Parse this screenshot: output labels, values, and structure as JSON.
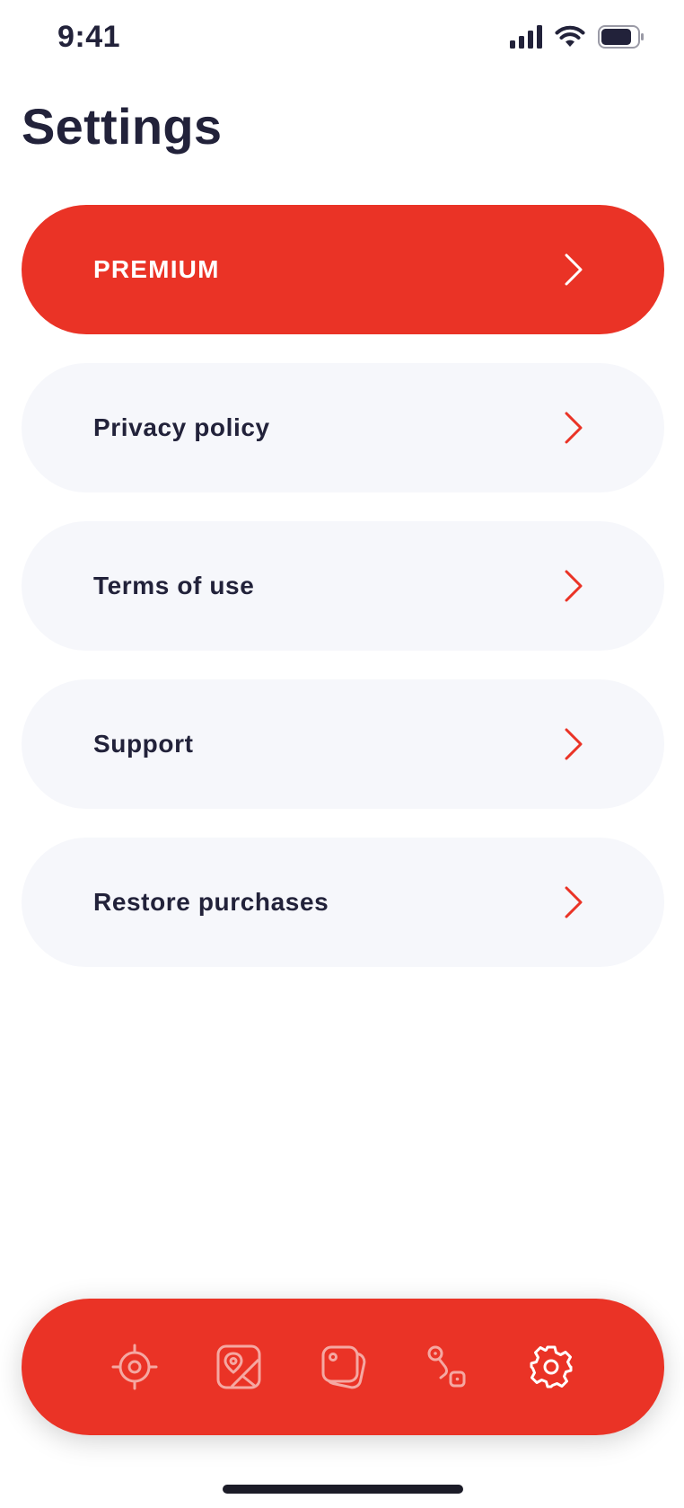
{
  "status_bar": {
    "time": "9:41",
    "icons": [
      "cellular-signal-icon",
      "wifi-icon",
      "battery-icon"
    ]
  },
  "page": {
    "title": "Settings"
  },
  "menu": {
    "items": [
      {
        "label": "PREMIUM",
        "style": "premium"
      },
      {
        "label": "Privacy policy",
        "style": "default"
      },
      {
        "label": "Terms of use",
        "style": "default"
      },
      {
        "label": "Support",
        "style": "default"
      },
      {
        "label": "Restore purchases",
        "style": "default"
      }
    ]
  },
  "tab_bar": {
    "tabs": [
      {
        "icon": "target-icon",
        "active": false
      },
      {
        "icon": "map-image-icon",
        "active": false
      },
      {
        "icon": "cards-icon",
        "active": false
      },
      {
        "icon": "route-icon",
        "active": false
      },
      {
        "icon": "settings-gear-icon",
        "active": true
      }
    ]
  },
  "colors": {
    "accent": "#ea3326",
    "text_dark": "#22223a",
    "row_background": "#f6f7fb",
    "inactive_tab_icon": "#f5a8a2",
    "active_tab_icon": "#ffffff"
  }
}
